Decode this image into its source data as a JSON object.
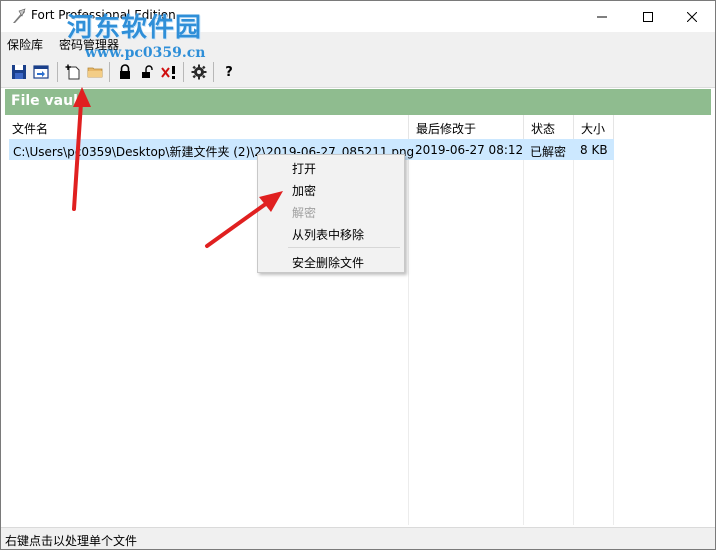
{
  "window": {
    "title": "Fort Professional Edition"
  },
  "watermark": {
    "logo": "河东软件园",
    "url": "www.pc0359.cn"
  },
  "menu": {
    "items": [
      "保险库",
      "密码管理器"
    ]
  },
  "toolbar": {
    "icons": [
      "save-icon",
      "import-icon",
      "new-file-icon",
      "folder-icon",
      "lock-icon",
      "unlock-icon",
      "remove-icon",
      "settings-icon",
      "help-icon"
    ],
    "help_label": "?"
  },
  "panel": {
    "title": "File vault"
  },
  "table": {
    "columns": [
      "文件名",
      "最后修改于",
      "状态",
      "大小"
    ],
    "rows": [
      {
        "file": "C:\\Users\\pc0359\\Desktop\\新建文件夹 (2)\\2\\2019-06-27_085211.png",
        "modified": "2019-06-27 08:12",
        "status": "已解密",
        "size": "8 KB"
      }
    ]
  },
  "context_menu": {
    "items": [
      "打开",
      "加密",
      "解密",
      "从列表中移除",
      "安全删除文件"
    ],
    "disabled": [
      "解密"
    ]
  },
  "statusbar": {
    "text": "右键点击以处理单个文件"
  },
  "colors": {
    "panel_header": "#8fbc8f",
    "selection": "#cce8ff",
    "annotation_arrow": "#e02020",
    "watermark": "#2f8fd8"
  }
}
